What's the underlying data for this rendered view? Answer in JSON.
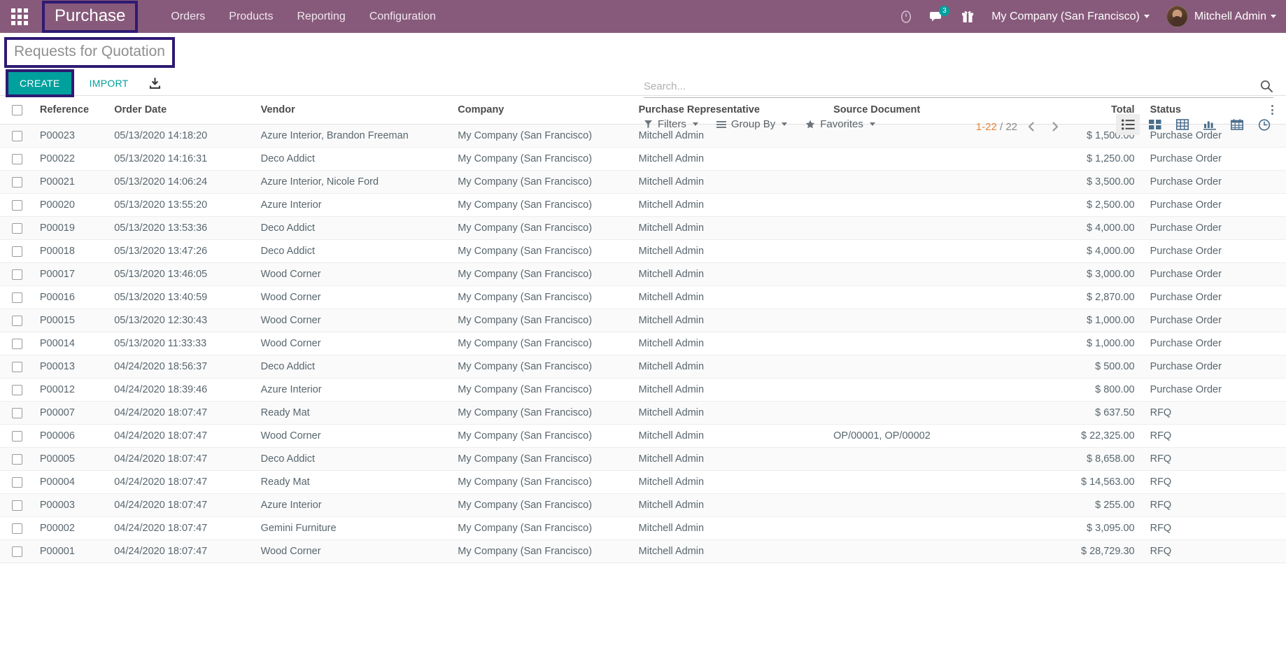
{
  "navbar": {
    "apps_icon": "apps-grid-icon",
    "brand": "Purchase",
    "menu": [
      {
        "label": "Orders"
      },
      {
        "label": "Products"
      },
      {
        "label": "Reporting"
      },
      {
        "label": "Configuration"
      }
    ],
    "icons": {
      "activity": "clock-icon",
      "messages": "chat-bubble-icon",
      "messages_count": "3",
      "gift": "gift-icon"
    },
    "company": "My Company (San Francisco)",
    "user": "Mitchell Admin"
  },
  "control_panel": {
    "breadcrumb": "Requests for Quotation",
    "create_label": "CREATE",
    "import_label": "IMPORT",
    "download_icon": "download-icon",
    "search_placeholder": "Search...",
    "search_value": "",
    "search_icon": "search-icon",
    "filters": [
      {
        "label": "Filters",
        "icon": "filter-icon"
      },
      {
        "label": "Group By",
        "icon": "bars-icon"
      },
      {
        "label": "Favorites",
        "icon": "star-icon"
      }
    ],
    "pager": {
      "range": "1-22",
      "separator": " / ",
      "total": "22",
      "full": "1-22 / 22"
    },
    "views": [
      {
        "name": "list",
        "icon": "list-icon",
        "active": true
      },
      {
        "name": "kanban",
        "icon": "kanban-icon",
        "active": false
      },
      {
        "name": "pivot",
        "icon": "pivot-table-icon",
        "active": false
      },
      {
        "name": "graph",
        "icon": "bar-chart-icon",
        "active": false
      },
      {
        "name": "calendar",
        "icon": "calendar-icon",
        "active": false
      },
      {
        "name": "activity",
        "icon": "clock-icon",
        "active": false
      }
    ]
  },
  "table": {
    "columns": [
      "Reference",
      "Order Date",
      "Vendor",
      "Company",
      "Purchase Representative",
      "Source Document",
      "Total",
      "Status"
    ],
    "rows": [
      {
        "reference": "P00023",
        "order_date": "05/13/2020 14:18:20",
        "vendor": "Azure Interior, Brandon Freeman",
        "company": "My Company (San Francisco)",
        "representative": "Mitchell Admin",
        "source_document": "",
        "total": "$ 1,500.00",
        "status": "Purchase Order"
      },
      {
        "reference": "P00022",
        "order_date": "05/13/2020 14:16:31",
        "vendor": "Deco Addict",
        "company": "My Company (San Francisco)",
        "representative": "Mitchell Admin",
        "source_document": "",
        "total": "$ 1,250.00",
        "status": "Purchase Order"
      },
      {
        "reference": "P00021",
        "order_date": "05/13/2020 14:06:24",
        "vendor": "Azure Interior, Nicole Ford",
        "company": "My Company (San Francisco)",
        "representative": "Mitchell Admin",
        "source_document": "",
        "total": "$ 3,500.00",
        "status": "Purchase Order"
      },
      {
        "reference": "P00020",
        "order_date": "05/13/2020 13:55:20",
        "vendor": "Azure Interior",
        "company": "My Company (San Francisco)",
        "representative": "Mitchell Admin",
        "source_document": "",
        "total": "$ 2,500.00",
        "status": "Purchase Order"
      },
      {
        "reference": "P00019",
        "order_date": "05/13/2020 13:53:36",
        "vendor": "Deco Addict",
        "company": "My Company (San Francisco)",
        "representative": "Mitchell Admin",
        "source_document": "",
        "total": "$ 4,000.00",
        "status": "Purchase Order"
      },
      {
        "reference": "P00018",
        "order_date": "05/13/2020 13:47:26",
        "vendor": "Deco Addict",
        "company": "My Company (San Francisco)",
        "representative": "Mitchell Admin",
        "source_document": "",
        "total": "$ 4,000.00",
        "status": "Purchase Order"
      },
      {
        "reference": "P00017",
        "order_date": "05/13/2020 13:46:05",
        "vendor": "Wood Corner",
        "company": "My Company (San Francisco)",
        "representative": "Mitchell Admin",
        "source_document": "",
        "total": "$ 3,000.00",
        "status": "Purchase Order"
      },
      {
        "reference": "P00016",
        "order_date": "05/13/2020 13:40:59",
        "vendor": "Wood Corner",
        "company": "My Company (San Francisco)",
        "representative": "Mitchell Admin",
        "source_document": "",
        "total": "$ 2,870.00",
        "status": "Purchase Order"
      },
      {
        "reference": "P00015",
        "order_date": "05/13/2020 12:30:43",
        "vendor": "Wood Corner",
        "company": "My Company (San Francisco)",
        "representative": "Mitchell Admin",
        "source_document": "",
        "total": "$ 1,000.00",
        "status": "Purchase Order"
      },
      {
        "reference": "P00014",
        "order_date": "05/13/2020 11:33:33",
        "vendor": "Wood Corner",
        "company": "My Company (San Francisco)",
        "representative": "Mitchell Admin",
        "source_document": "",
        "total": "$ 1,000.00",
        "status": "Purchase Order"
      },
      {
        "reference": "P00013",
        "order_date": "04/24/2020 18:56:37",
        "vendor": "Deco Addict",
        "company": "My Company (San Francisco)",
        "representative": "Mitchell Admin",
        "source_document": "",
        "total": "$ 500.00",
        "status": "Purchase Order"
      },
      {
        "reference": "P00012",
        "order_date": "04/24/2020 18:39:46",
        "vendor": "Azure Interior",
        "company": "My Company (San Francisco)",
        "representative": "Mitchell Admin",
        "source_document": "",
        "total": "$ 800.00",
        "status": "Purchase Order"
      },
      {
        "reference": "P00007",
        "order_date": "04/24/2020 18:07:47",
        "vendor": "Ready Mat",
        "company": "My Company (San Francisco)",
        "representative": "Mitchell Admin",
        "source_document": "",
        "total": "$ 637.50",
        "status": "RFQ"
      },
      {
        "reference": "P00006",
        "order_date": "04/24/2020 18:07:47",
        "vendor": "Wood Corner",
        "company": "My Company (San Francisco)",
        "representative": "Mitchell Admin",
        "source_document": "OP/00001, OP/00002",
        "total": "$ 22,325.00",
        "status": "RFQ"
      },
      {
        "reference": "P00005",
        "order_date": "04/24/2020 18:07:47",
        "vendor": "Deco Addict",
        "company": "My Company (San Francisco)",
        "representative": "Mitchell Admin",
        "source_document": "",
        "total": "$ 8,658.00",
        "status": "RFQ"
      },
      {
        "reference": "P00004",
        "order_date": "04/24/2020 18:07:47",
        "vendor": "Ready Mat",
        "company": "My Company (San Francisco)",
        "representative": "Mitchell Admin",
        "source_document": "",
        "total": "$ 14,563.00",
        "status": "RFQ"
      },
      {
        "reference": "P00003",
        "order_date": "04/24/2020 18:07:47",
        "vendor": "Azure Interior",
        "company": "My Company (San Francisco)",
        "representative": "Mitchell Admin",
        "source_document": "",
        "total": "$ 255.00",
        "status": "RFQ"
      },
      {
        "reference": "P00002",
        "order_date": "04/24/2020 18:07:47",
        "vendor": "Gemini Furniture",
        "company": "My Company (San Francisco)",
        "representative": "Mitchell Admin",
        "source_document": "",
        "total": "$ 3,095.00",
        "status": "RFQ"
      },
      {
        "reference": "P00001",
        "order_date": "04/24/2020 18:07:47",
        "vendor": "Wood Corner",
        "company": "My Company (San Francisco)",
        "representative": "Mitchell Admin",
        "source_document": "",
        "total": "$ 28,729.30",
        "status": "RFQ"
      }
    ]
  },
  "colors": {
    "brand_purple": "#875A7B",
    "accent_teal": "#00A09D",
    "highlight_outline": "#2e1a72",
    "pager_current": "#e8843c"
  }
}
